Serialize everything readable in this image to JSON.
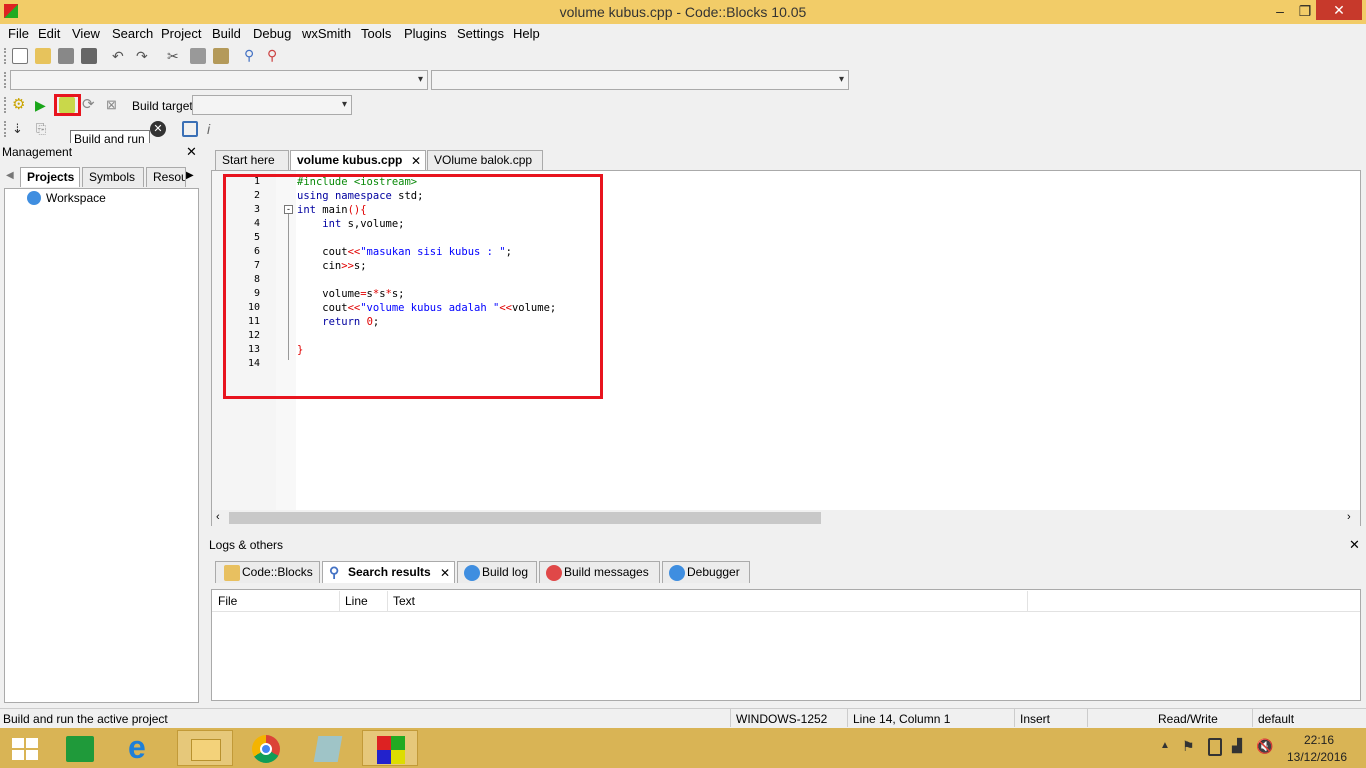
{
  "window": {
    "title": "volume kubus.cpp - Code::Blocks 10.05"
  },
  "menu": [
    "File",
    "Edit",
    "View",
    "Search",
    "Project",
    "Build",
    "Debug",
    "wxSmith",
    "Tools",
    "Plugins",
    "Settings",
    "Help"
  ],
  "toolbar": {
    "build_target_label": "Build target:",
    "tooltip": "Build and run"
  },
  "management": {
    "title": "Management",
    "tabs": [
      "Projects",
      "Symbols",
      "Resou"
    ],
    "tree_root": "Workspace"
  },
  "editor": {
    "tabs": [
      "Start here",
      "volume kubus.cpp",
      "VOlume balok.cpp"
    ],
    "line_numbers": [
      "1",
      "2",
      "3",
      "4",
      "5",
      "6",
      "7",
      "8",
      "9",
      "10",
      "11",
      "12",
      "13",
      "14"
    ]
  },
  "logs": {
    "title": "Logs & others",
    "tabs": [
      "Code::Blocks",
      "Search results",
      "Build log",
      "Build messages",
      "Debugger"
    ],
    "columns": [
      "File",
      "Line",
      "Text"
    ]
  },
  "status": {
    "message": "Build and run the active project",
    "encoding": "WINDOWS-1252",
    "position": "Line 14, Column 1",
    "mode": "Insert",
    "access": "Read/Write",
    "profile": "default"
  },
  "taskbar": {
    "time": "22:16",
    "date": "13/12/2016"
  },
  "colors": {
    "titlebar": "#f2cc68",
    "highlight": "#e8141e",
    "taskbar": "#d9b455"
  }
}
